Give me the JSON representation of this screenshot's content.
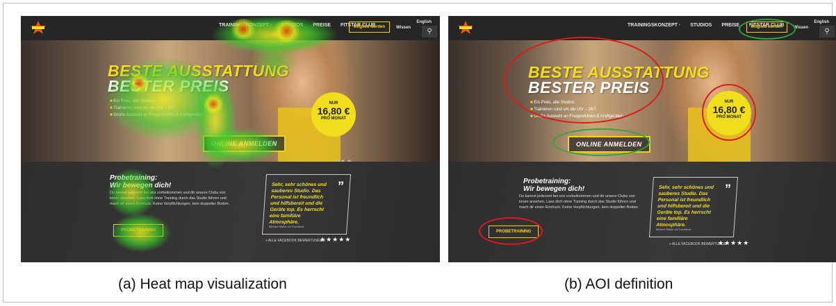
{
  "site": {
    "nav_items": [
      "Trainingskonzept ·",
      "Studios",
      "Preise",
      "FitStar Club"
    ],
    "cta_label": "Mitglied werden",
    "lang_label": "English",
    "wissen_label": "Wissen",
    "search_glyph": "⚲"
  },
  "hero": {
    "headline_line1": "BESTE AUSSTATTUNG",
    "headline_line2": "BESTER PREIS",
    "bullets": [
      "Ein Preis, alle Studios",
      "Trainieren rund um die Uhr – 24/7",
      "Große Auswahl an Freigewichten & Kraftgeräten"
    ],
    "price_top": "NUR",
    "price_value": "16,80 €",
    "price_bottom": "PRO MONAT",
    "cta": "ONLINE ANMELDEN",
    "slider_dots": "■ ■ ■"
  },
  "probetraining": {
    "title_line1": "Probetraining:",
    "title_line2": "Wir bewegen dich!",
    "text": "Du kannst jederzeit bei uns vorbeikommen und dir unsere Clubs von innen ansehen. Lass dich ohne Training durch das Studio führen und mach dir einen Eindruck. Keine Verpflichtungen, kein doppelter Boden.",
    "button": "PROBETRAINING"
  },
  "quote": {
    "text": "Sehr, sehr schönes und sauberes Studio. Das Personal ist freundlich und hilfsbereit und die Geräte top. Es herrscht eine familiäre Atmosphäre.",
    "mark": "”",
    "source": "Michael Müller via Facebook",
    "facebook_link": "» ALLE FACEBOOK BEWERTUNGEN",
    "stars": "★★★★★"
  },
  "captions": {
    "a": "(a) Heat map visualization",
    "b": "(b) AOI definition"
  },
  "colors": {
    "accent_yellow": "#f2de1c",
    "aoi_red": "#e01919",
    "aoi_green": "#2aa93a",
    "heat_green": "#39d12b",
    "heat_yellow": "#f5f01e",
    "heat_red": "#ff2a00"
  }
}
